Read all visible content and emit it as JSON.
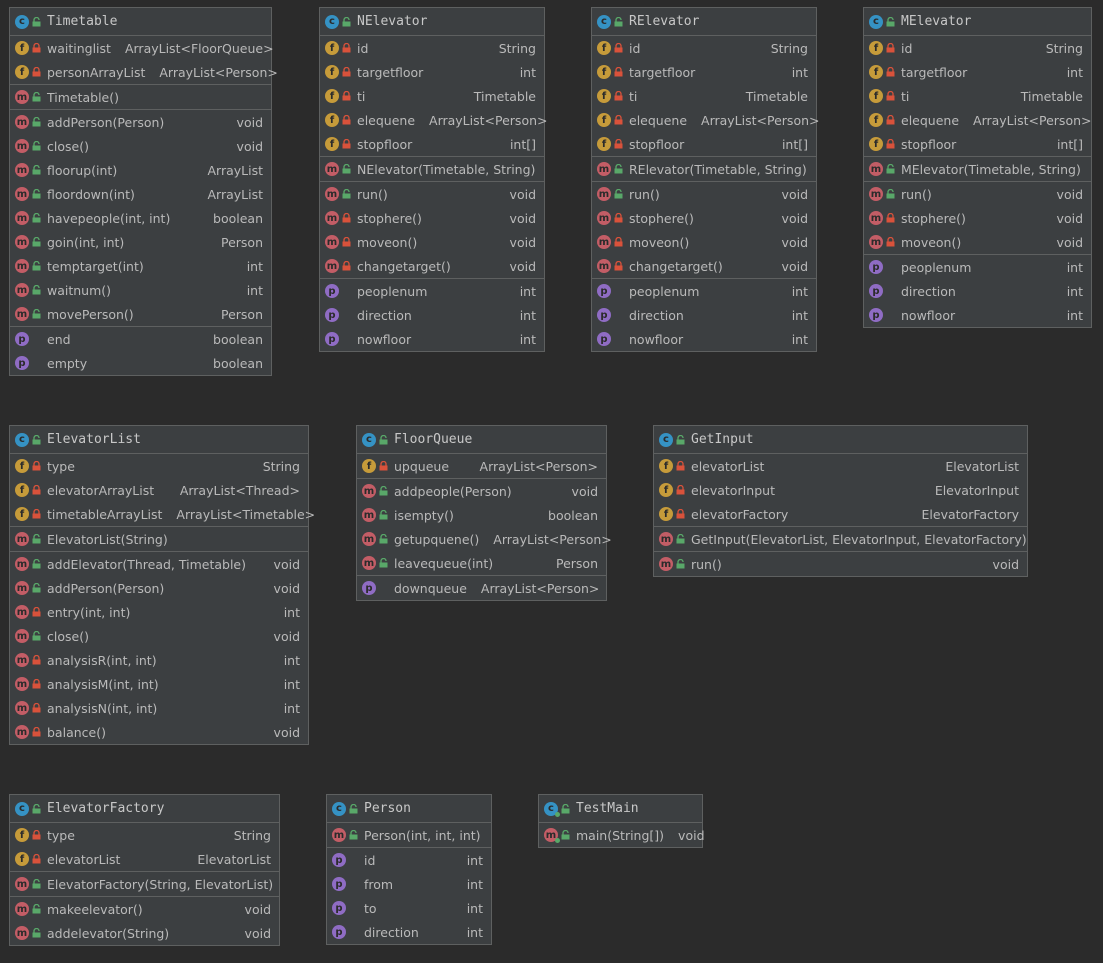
{
  "diagram": {
    "classes": [
      {
        "key": "timetable",
        "name": "Timetable",
        "kind": "class",
        "sections": [
          [
            {
              "kind": "f",
              "vis": "private",
              "name": "waitinglist",
              "type": "ArrayList<FloorQueue>"
            },
            {
              "kind": "f",
              "vis": "private",
              "name": "personArrayList",
              "type": "ArrayList<Person>"
            }
          ],
          [
            {
              "kind": "m",
              "vis": "public",
              "name": "Timetable()",
              "type": ""
            }
          ],
          [
            {
              "kind": "m",
              "vis": "public",
              "name": "addPerson(Person)",
              "type": "void"
            },
            {
              "kind": "m",
              "vis": "public",
              "name": "close()",
              "type": "void"
            },
            {
              "kind": "m",
              "vis": "public",
              "name": "floorup(int)",
              "type": "ArrayList"
            },
            {
              "kind": "m",
              "vis": "public",
              "name": "floordown(int)",
              "type": "ArrayList"
            },
            {
              "kind": "m",
              "vis": "public",
              "name": "havepeople(int, int)",
              "type": "boolean"
            },
            {
              "kind": "m",
              "vis": "public",
              "name": "goin(int, int)",
              "type": "Person"
            },
            {
              "kind": "m",
              "vis": "public",
              "name": "temptarget(int)",
              "type": "int"
            },
            {
              "kind": "m",
              "vis": "public",
              "name": "waitnum()",
              "type": "int"
            },
            {
              "kind": "m",
              "vis": "public",
              "name": "movePerson()",
              "type": "Person"
            }
          ],
          [
            {
              "kind": "p",
              "vis": "none",
              "name": "end",
              "type": "boolean"
            },
            {
              "kind": "p",
              "vis": "none",
              "name": "empty",
              "type": "boolean"
            }
          ]
        ]
      },
      {
        "key": "nelevator",
        "name": "NElevator",
        "kind": "class",
        "sections": [
          [
            {
              "kind": "f",
              "vis": "private",
              "name": "id",
              "type": "String"
            },
            {
              "kind": "f",
              "vis": "private",
              "name": "targetfloor",
              "type": "int"
            },
            {
              "kind": "f",
              "vis": "private",
              "name": "ti",
              "type": "Timetable"
            },
            {
              "kind": "f",
              "vis": "private",
              "name": "elequene",
              "type": "ArrayList<Person>"
            },
            {
              "kind": "f",
              "vis": "private",
              "name": "stopfloor",
              "type": "int[]"
            }
          ],
          [
            {
              "kind": "m",
              "vis": "public",
              "name": "NElevator(Timetable, String)",
              "type": ""
            }
          ],
          [
            {
              "kind": "m",
              "vis": "public",
              "name": "run()",
              "type": "void"
            },
            {
              "kind": "m",
              "vis": "private",
              "name": "stophere()",
              "type": "void"
            },
            {
              "kind": "m",
              "vis": "private",
              "name": "moveon()",
              "type": "void"
            },
            {
              "kind": "m",
              "vis": "private",
              "name": "changetarget()",
              "type": "void"
            }
          ],
          [
            {
              "kind": "p",
              "vis": "none",
              "name": "peoplenum",
              "type": "int"
            },
            {
              "kind": "p",
              "vis": "none",
              "name": "direction",
              "type": "int"
            },
            {
              "kind": "p",
              "vis": "none",
              "name": "nowfloor",
              "type": "int"
            }
          ]
        ]
      },
      {
        "key": "relevator",
        "name": "RElevator",
        "kind": "class",
        "sections": [
          [
            {
              "kind": "f",
              "vis": "private",
              "name": "id",
              "type": "String"
            },
            {
              "kind": "f",
              "vis": "private",
              "name": "targetfloor",
              "type": "int"
            },
            {
              "kind": "f",
              "vis": "private",
              "name": "ti",
              "type": "Timetable"
            },
            {
              "kind": "f",
              "vis": "private",
              "name": "elequene",
              "type": "ArrayList<Person>"
            },
            {
              "kind": "f",
              "vis": "private",
              "name": "stopfloor",
              "type": "int[]"
            }
          ],
          [
            {
              "kind": "m",
              "vis": "public",
              "name": "RElevator(Timetable, String)",
              "type": ""
            }
          ],
          [
            {
              "kind": "m",
              "vis": "public",
              "name": "run()",
              "type": "void"
            },
            {
              "kind": "m",
              "vis": "private",
              "name": "stophere()",
              "type": "void"
            },
            {
              "kind": "m",
              "vis": "private",
              "name": "moveon()",
              "type": "void"
            },
            {
              "kind": "m",
              "vis": "private",
              "name": "changetarget()",
              "type": "void"
            }
          ],
          [
            {
              "kind": "p",
              "vis": "none",
              "name": "peoplenum",
              "type": "int"
            },
            {
              "kind": "p",
              "vis": "none",
              "name": "direction",
              "type": "int"
            },
            {
              "kind": "p",
              "vis": "none",
              "name": "nowfloor",
              "type": "int"
            }
          ]
        ]
      },
      {
        "key": "melevator",
        "name": "MElevator",
        "kind": "class",
        "sections": [
          [
            {
              "kind": "f",
              "vis": "private",
              "name": "id",
              "type": "String"
            },
            {
              "kind": "f",
              "vis": "private",
              "name": "targetfloor",
              "type": "int"
            },
            {
              "kind": "f",
              "vis": "private",
              "name": "ti",
              "type": "Timetable"
            },
            {
              "kind": "f",
              "vis": "private",
              "name": "elequene",
              "type": "ArrayList<Person>"
            },
            {
              "kind": "f",
              "vis": "private",
              "name": "stopfloor",
              "type": "int[]"
            }
          ],
          [
            {
              "kind": "m",
              "vis": "public",
              "name": "MElevator(Timetable, String)",
              "type": ""
            }
          ],
          [
            {
              "kind": "m",
              "vis": "public",
              "name": "run()",
              "type": "void"
            },
            {
              "kind": "m",
              "vis": "private",
              "name": "stophere()",
              "type": "void"
            },
            {
              "kind": "m",
              "vis": "private",
              "name": "moveon()",
              "type": "void"
            }
          ],
          [
            {
              "kind": "p",
              "vis": "none",
              "name": "peoplenum",
              "type": "int"
            },
            {
              "kind": "p",
              "vis": "none",
              "name": "direction",
              "type": "int"
            },
            {
              "kind": "p",
              "vis": "none",
              "name": "nowfloor",
              "type": "int"
            }
          ]
        ]
      },
      {
        "key": "elevatorlist",
        "name": "ElevatorList",
        "kind": "class",
        "sections": [
          [
            {
              "kind": "f",
              "vis": "private",
              "name": "type",
              "type": "String"
            },
            {
              "kind": "f",
              "vis": "private",
              "name": "elevatorArrayList",
              "type": "ArrayList<Thread>"
            },
            {
              "kind": "f",
              "vis": "private",
              "name": "timetableArrayList",
              "type": "ArrayList<Timetable>"
            }
          ],
          [
            {
              "kind": "m",
              "vis": "public",
              "name": "ElevatorList(String)",
              "type": ""
            }
          ],
          [
            {
              "kind": "m",
              "vis": "public",
              "name": "addElevator(Thread, Timetable)",
              "type": "void"
            },
            {
              "kind": "m",
              "vis": "public",
              "name": "addPerson(Person)",
              "type": "void"
            },
            {
              "kind": "m",
              "vis": "private",
              "name": "entry(int, int)",
              "type": "int"
            },
            {
              "kind": "m",
              "vis": "public",
              "name": "close()",
              "type": "void"
            },
            {
              "kind": "m",
              "vis": "private",
              "name": "analysisR(int, int)",
              "type": "int"
            },
            {
              "kind": "m",
              "vis": "private",
              "name": "analysisM(int, int)",
              "type": "int"
            },
            {
              "kind": "m",
              "vis": "private",
              "name": "analysisN(int, int)",
              "type": "int"
            },
            {
              "kind": "m",
              "vis": "private",
              "name": "balance()",
              "type": "void"
            }
          ]
        ]
      },
      {
        "key": "floorqueue",
        "name": "FloorQueue",
        "kind": "class",
        "sections": [
          [
            {
              "kind": "f",
              "vis": "private",
              "name": "upqueue",
              "type": "ArrayList<Person>"
            }
          ],
          [
            {
              "kind": "m",
              "vis": "public",
              "name": "addpeople(Person)",
              "type": "void"
            },
            {
              "kind": "m",
              "vis": "public",
              "name": "isempty()",
              "type": "boolean"
            },
            {
              "kind": "m",
              "vis": "public",
              "name": "getupquene()",
              "type": "ArrayList<Person>"
            },
            {
              "kind": "m",
              "vis": "public",
              "name": "leavequeue(int)",
              "type": "Person"
            }
          ],
          [
            {
              "kind": "p",
              "vis": "none",
              "name": "downqueue",
              "type": "ArrayList<Person>"
            }
          ]
        ]
      },
      {
        "key": "getinput",
        "name": "GetInput",
        "kind": "class",
        "sections": [
          [
            {
              "kind": "f",
              "vis": "private",
              "name": "elevatorList",
              "type": "ElevatorList"
            },
            {
              "kind": "f",
              "vis": "private",
              "name": "elevatorInput",
              "type": "ElevatorInput"
            },
            {
              "kind": "f",
              "vis": "private",
              "name": "elevatorFactory",
              "type": "ElevatorFactory"
            }
          ],
          [
            {
              "kind": "m",
              "vis": "public",
              "name": "GetInput(ElevatorList, ElevatorInput, ElevatorFactory)",
              "type": ""
            }
          ],
          [
            {
              "kind": "m",
              "vis": "public",
              "name": "run()",
              "type": "void"
            }
          ]
        ]
      },
      {
        "key": "elevatorfactory",
        "name": "ElevatorFactory",
        "kind": "class",
        "sections": [
          [
            {
              "kind": "f",
              "vis": "private",
              "name": "type",
              "type": "String"
            },
            {
              "kind": "f",
              "vis": "private",
              "name": "elevatorList",
              "type": "ElevatorList"
            }
          ],
          [
            {
              "kind": "m",
              "vis": "public",
              "name": "ElevatorFactory(String, ElevatorList)",
              "type": ""
            }
          ],
          [
            {
              "kind": "m",
              "vis": "public",
              "name": "makeelevator()",
              "type": "void"
            },
            {
              "kind": "m",
              "vis": "public",
              "name": "addelevator(String)",
              "type": "void"
            }
          ]
        ]
      },
      {
        "key": "person",
        "name": "Person",
        "kind": "class",
        "sections": [
          [
            {
              "kind": "m",
              "vis": "public",
              "name": "Person(int, int, int)",
              "type": ""
            }
          ],
          [
            {
              "kind": "p",
              "vis": "none",
              "name": "id",
              "type": "int"
            },
            {
              "kind": "p",
              "vis": "none",
              "name": "from",
              "type": "int"
            },
            {
              "kind": "p",
              "vis": "none",
              "name": "to",
              "type": "int"
            },
            {
              "kind": "p",
              "vis": "none",
              "name": "direction",
              "type": "int"
            }
          ]
        ]
      },
      {
        "key": "testmain",
        "name": "TestMain",
        "kind": "class-main",
        "sections": [
          [
            {
              "kind": "m",
              "vis": "public",
              "static": true,
              "name": "main(String[])",
              "type": "void"
            }
          ]
        ]
      }
    ]
  },
  "icons": {
    "class": "class-icon",
    "field": "field-icon",
    "method": "method-icon",
    "property": "property-icon",
    "private": "private-lock-icon",
    "public": "public-unlock-icon"
  },
  "colors": {
    "background": "#2b2b2b",
    "panel": "#3c3f41",
    "border": "#5e6060",
    "text": "#bababa",
    "class_badge": "#3592c4",
    "field_badge": "#c69b3a",
    "method_badge": "#c35d66",
    "property_badge": "#8f6cc4",
    "private_lock": "#d9523b",
    "public_lock": "#59a869"
  }
}
